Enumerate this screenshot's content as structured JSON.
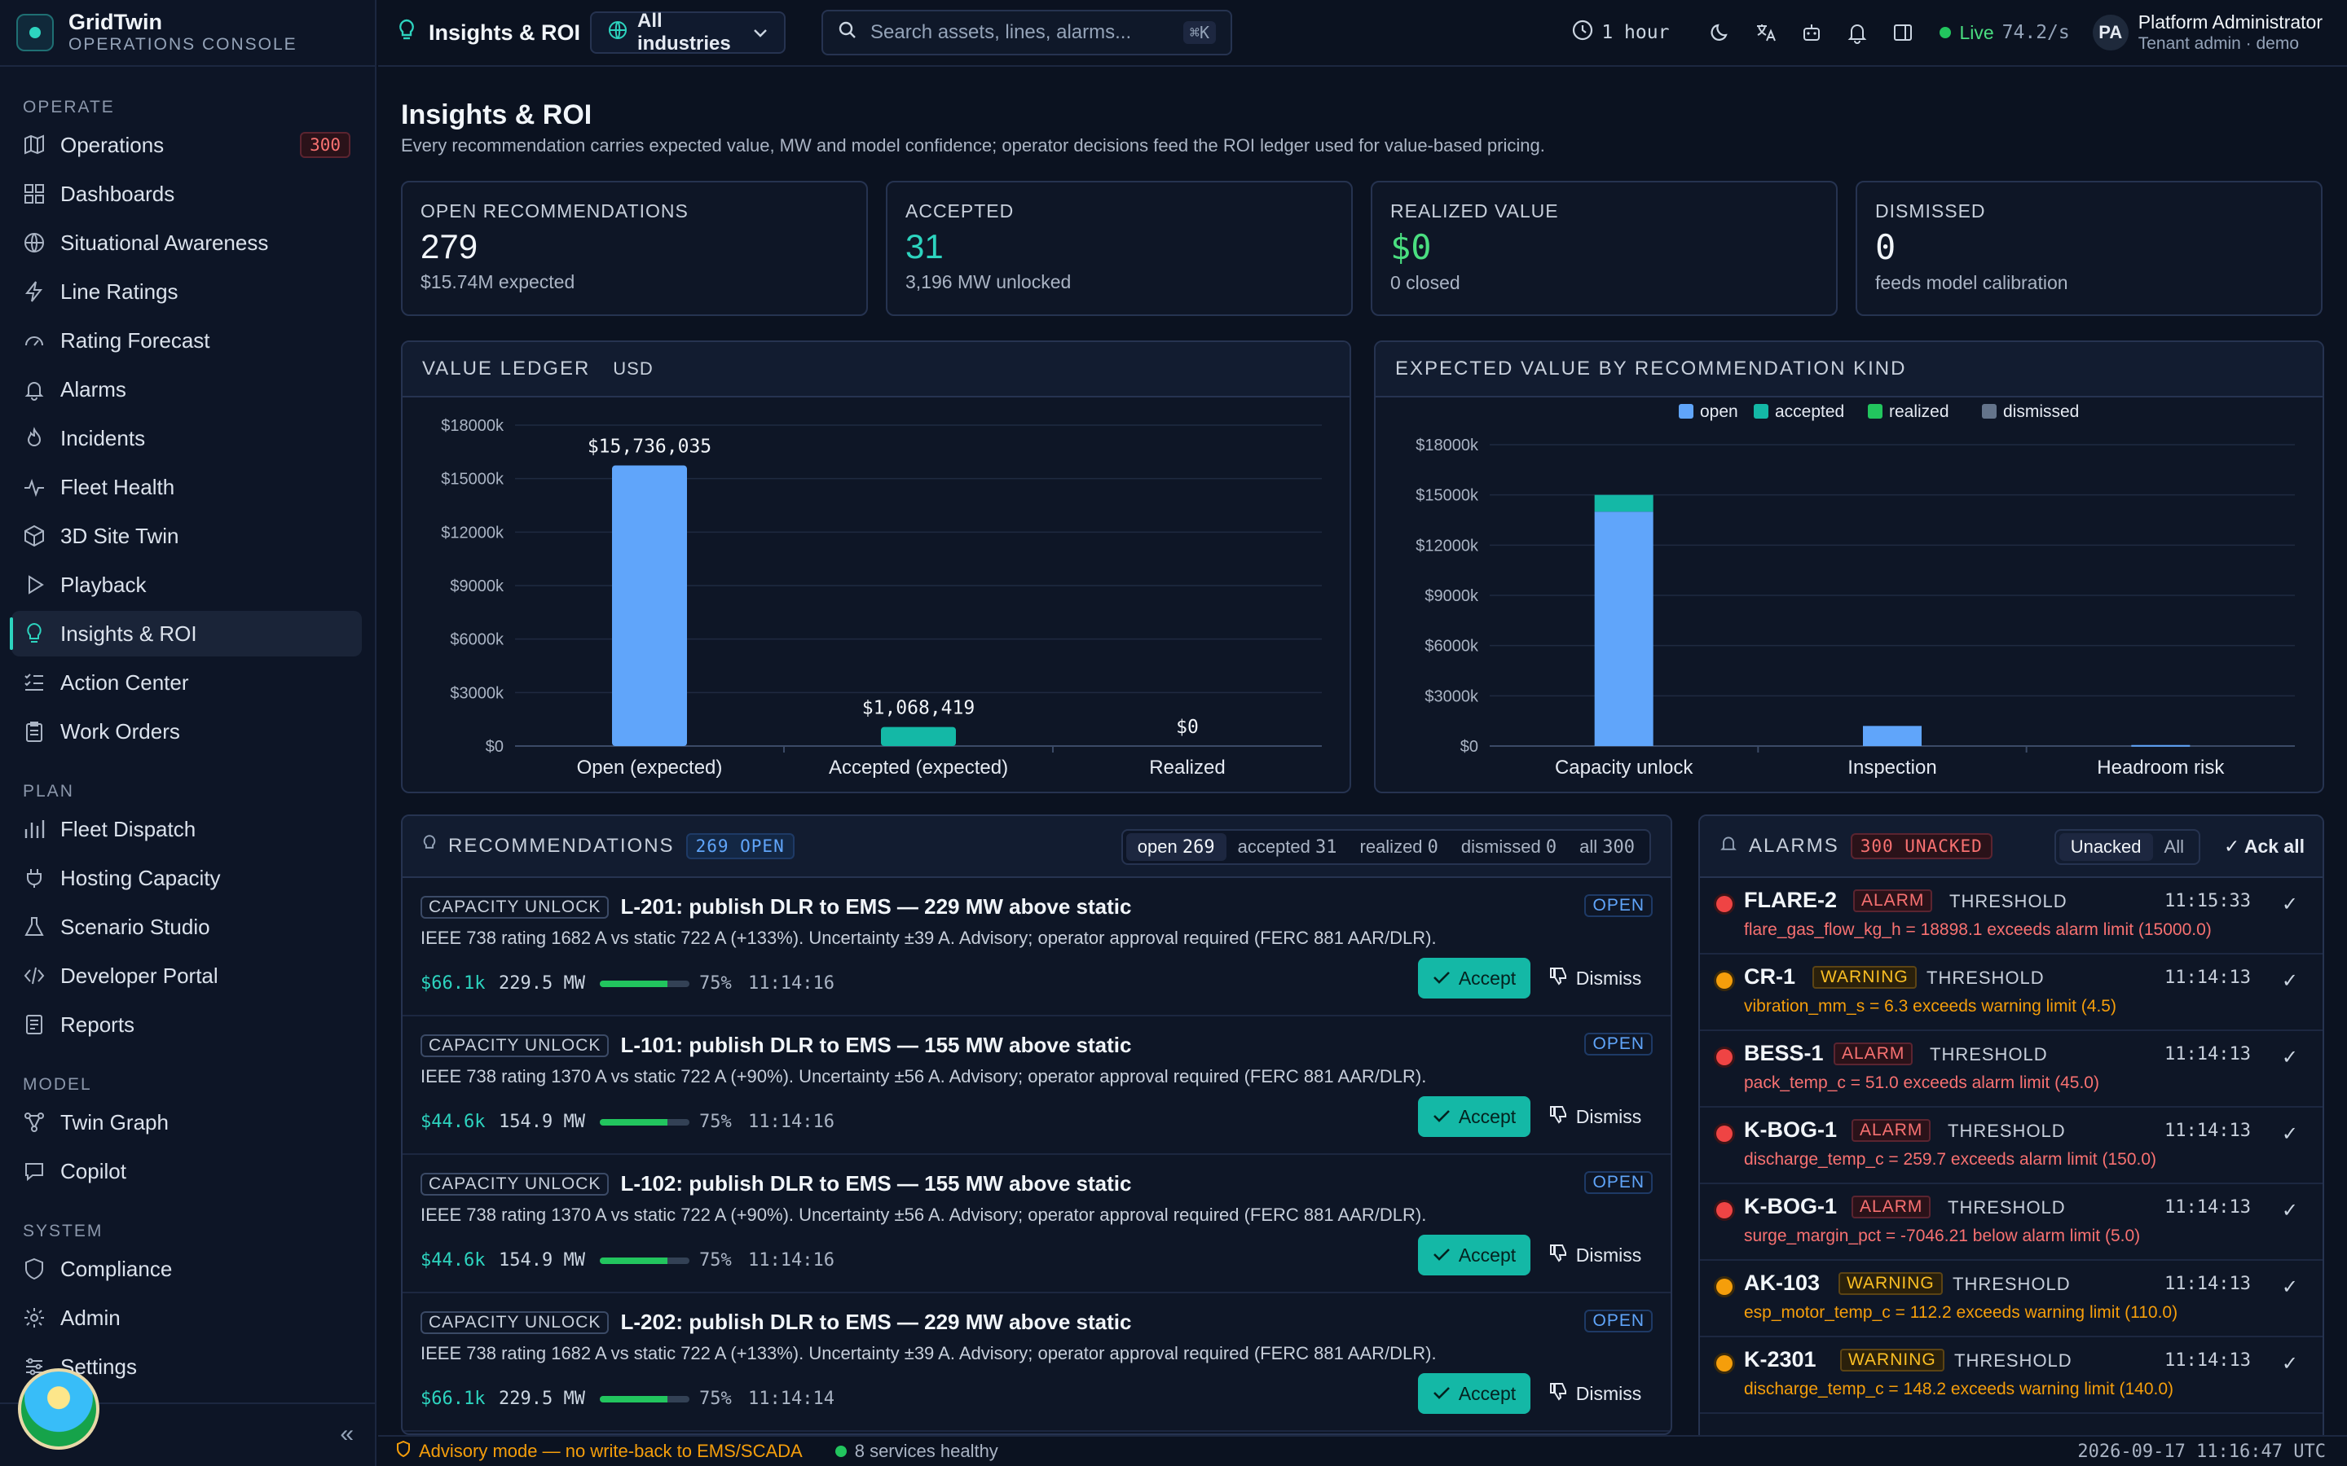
{
  "brand": {
    "name": "GridTwin",
    "subtitle": "OPERATIONS CONSOLE"
  },
  "sidebar": {
    "sections": [
      {
        "title": "OPERATE",
        "items": [
          {
            "label": "Operations",
            "icon": "map-icon",
            "badge": "300"
          },
          {
            "label": "Dashboards",
            "icon": "grid-icon"
          },
          {
            "label": "Situational Awareness",
            "icon": "globe-icon"
          },
          {
            "label": "Line Ratings",
            "icon": "bolt-icon"
          },
          {
            "label": "Rating Forecast",
            "icon": "gauge-icon"
          },
          {
            "label": "Alarms",
            "icon": "bell-icon"
          },
          {
            "label": "Incidents",
            "icon": "flame-icon"
          },
          {
            "label": "Fleet Health",
            "icon": "pulse-icon"
          },
          {
            "label": "3D Site Twin",
            "icon": "cube-icon"
          },
          {
            "label": "Playback",
            "icon": "play-icon"
          },
          {
            "label": "Insights & ROI",
            "icon": "bulb-icon",
            "active": true
          },
          {
            "label": "Action Center",
            "icon": "checklist-icon"
          },
          {
            "label": "Work Orders",
            "icon": "clipboard-icon"
          }
        ]
      },
      {
        "title": "PLAN",
        "items": [
          {
            "label": "Fleet Dispatch",
            "icon": "bar-chart-icon"
          },
          {
            "label": "Hosting Capacity",
            "icon": "plug-icon"
          },
          {
            "label": "Scenario Studio",
            "icon": "flask-icon"
          },
          {
            "label": "Developer Portal",
            "icon": "code-icon"
          },
          {
            "label": "Reports",
            "icon": "report-icon"
          }
        ]
      },
      {
        "title": "MODEL",
        "items": [
          {
            "label": "Twin Graph",
            "icon": "network-icon"
          },
          {
            "label": "Copilot",
            "icon": "chat-icon"
          }
        ]
      },
      {
        "title": "SYSTEM",
        "items": [
          {
            "label": "Compliance",
            "icon": "shield-icon"
          },
          {
            "label": "Admin",
            "icon": "gear-icon"
          },
          {
            "label": "Settings",
            "icon": "sliders-icon"
          }
        ]
      }
    ]
  },
  "topbar": {
    "title": "Insights & ROI",
    "industry": "All industries",
    "search_placeholder": "Search assets, lines, alarms...",
    "search_shortcut": "⌘K",
    "time_range": "1 hour",
    "live_label": "Live",
    "live_rate": "74.2/s",
    "user_initials": "PA",
    "user_name": "Platform Administrator",
    "user_role": "Tenant admin · demo"
  },
  "page": {
    "title": "Insights & ROI",
    "subtitle": "Every recommendation carries expected value, MW and model confidence; operator decisions feed the ROI ledger used for value-based pricing."
  },
  "kpis": [
    {
      "label": "OPEN RECOMMENDATIONS",
      "value": "279",
      "sub": "$15.74M expected",
      "color": "#f1f5f9"
    },
    {
      "label": "ACCEPTED",
      "value": "31",
      "sub": "3,196 MW unlocked",
      "color": "#2dd4bf"
    },
    {
      "label": "REALIZED VALUE",
      "value": "$0",
      "sub": "0 closed",
      "color": "#4ade80"
    },
    {
      "label": "DISMISSED",
      "value": "0",
      "sub": "feeds model calibration",
      "color": "#f1f5f9"
    }
  ],
  "ledger_panel": {
    "title": "VALUE LEDGER",
    "unit": "USD"
  },
  "kind_panel": {
    "title": "EXPECTED VALUE BY RECOMMENDATION KIND"
  },
  "chart_data": [
    {
      "type": "bar",
      "categories": [
        "Open (expected)",
        "Accepted (expected)",
        "Realized"
      ],
      "values": [
        15736035,
        1068419,
        0
      ],
      "data_labels": [
        "$15,736,035",
        "$1,068,419",
        "$0"
      ],
      "colors": [
        "#60a5fa",
        "#14b8a6",
        "#22c55e"
      ],
      "yticks": [
        "$0",
        "$3000k",
        "$6000k",
        "$9000k",
        "$12000k",
        "$15000k",
        "$18000k"
      ],
      "ylim": [
        0,
        18000000
      ],
      "grid": true
    },
    {
      "type": "bar",
      "stacked": true,
      "categories": [
        "Capacity unlock",
        "Inspection",
        "Headroom risk"
      ],
      "series": [
        {
          "name": "open",
          "color": "#60a5fa",
          "values": [
            14000000,
            1200000,
            60000
          ]
        },
        {
          "name": "accepted",
          "color": "#14b8a6",
          "values": [
            1000000,
            0,
            0
          ]
        },
        {
          "name": "realized",
          "color": "#22c55e",
          "values": [
            0,
            0,
            0
          ]
        },
        {
          "name": "dismissed",
          "color": "#64748b",
          "values": [
            0,
            0,
            0
          ]
        }
      ],
      "yticks": [
        "$0",
        "$3000k",
        "$6000k",
        "$9000k",
        "$12000k",
        "$15000k",
        "$18000k"
      ],
      "ylim": [
        0,
        18000000
      ],
      "legend": "top",
      "grid": true
    }
  ],
  "recommendations": {
    "title": "RECOMMENDATIONS",
    "count": "269 OPEN",
    "filters": [
      {
        "label": "open",
        "count": "269",
        "active": true
      },
      {
        "label": "accepted",
        "count": "31"
      },
      {
        "label": "realized",
        "count": "0"
      },
      {
        "label": "dismissed",
        "count": "0"
      },
      {
        "label": "all",
        "count": "300"
      }
    ],
    "accept_label": "Accept",
    "dismiss_label": "Dismiss",
    "items": [
      {
        "kind": "CAPACITY UNLOCK",
        "title": "L-201: publish DLR to EMS — 229 MW above static",
        "status": "OPEN",
        "desc": "IEEE 738 rating 1682 A vs static 722 A (+133%). Uncertainty ±39 A. Advisory; operator approval required (FERC 881 AAR/DLR).",
        "value": "$66.1k",
        "mw": "229.5 MW",
        "confidence": 0.75,
        "confidence_label": "75%",
        "time": "11:14:16"
      },
      {
        "kind": "CAPACITY UNLOCK",
        "title": "L-101: publish DLR to EMS — 155 MW above static",
        "status": "OPEN",
        "desc": "IEEE 738 rating 1370 A vs static 722 A (+90%). Uncertainty ±56 A. Advisory; operator approval required (FERC 881 AAR/DLR).",
        "value": "$44.6k",
        "mw": "154.9 MW",
        "confidence": 0.75,
        "confidence_label": "75%",
        "time": "11:14:16"
      },
      {
        "kind": "CAPACITY UNLOCK",
        "title": "L-102: publish DLR to EMS — 155 MW above static",
        "status": "OPEN",
        "desc": "IEEE 738 rating 1370 A vs static 722 A (+90%). Uncertainty ±56 A. Advisory; operator approval required (FERC 881 AAR/DLR).",
        "value": "$44.6k",
        "mw": "154.9 MW",
        "confidence": 0.75,
        "confidence_label": "75%",
        "time": "11:14:16"
      },
      {
        "kind": "CAPACITY UNLOCK",
        "title": "L-202: publish DLR to EMS — 229 MW above static",
        "status": "OPEN",
        "desc": "IEEE 738 rating 1682 A vs static 722 A (+133%). Uncertainty ±39 A. Advisory; operator approval required (FERC 881 AAR/DLR).",
        "value": "$66.1k",
        "mw": "229.5 MW",
        "confidence": 0.75,
        "confidence_label": "75%",
        "time": "11:14:14"
      }
    ]
  },
  "alarms": {
    "title": "ALARMS",
    "count": "300 UNACKED",
    "filters": [
      {
        "label": "Unacked",
        "active": true
      },
      {
        "label": "All"
      }
    ],
    "ack_all": "Ack all",
    "items": [
      {
        "asset": "FLARE-2",
        "severity": "ALARM",
        "type": "THRESHOLD",
        "time": "11:15:33",
        "msg": "flare_gas_flow_kg_h = 18898.1 exceeds alarm limit (15000.0)"
      },
      {
        "asset": "CR-1",
        "severity": "WARNING",
        "type": "THRESHOLD",
        "time": "11:14:13",
        "msg": "vibration_mm_s = 6.3 exceeds warning limit (4.5)"
      },
      {
        "asset": "BESS-1",
        "severity": "ALARM",
        "type": "THRESHOLD",
        "time": "11:14:13",
        "msg": "pack_temp_c = 51.0 exceeds alarm limit (45.0)"
      },
      {
        "asset": "K-BOG-1",
        "severity": "ALARM",
        "type": "THRESHOLD",
        "time": "11:14:13",
        "msg": "discharge_temp_c = 259.7 exceeds alarm limit (150.0)"
      },
      {
        "asset": "K-BOG-1",
        "severity": "ALARM",
        "type": "THRESHOLD",
        "time": "11:14:13",
        "msg": "surge_margin_pct = -7046.21 below alarm limit (5.0)"
      },
      {
        "asset": "AK-103",
        "severity": "WARNING",
        "type": "THRESHOLD",
        "time": "11:14:13",
        "msg": "esp_motor_temp_c = 112.2 exceeds warning limit (110.0)"
      },
      {
        "asset": "K-2301",
        "severity": "WARNING",
        "type": "THRESHOLD",
        "time": "11:14:13",
        "msg": "discharge_temp_c = 148.2 exceeds warning limit (140.0)"
      }
    ]
  },
  "status": {
    "advisory": "Advisory mode — no write-back to EMS/SCADA",
    "services": "8 services healthy",
    "clock": "2026-09-17 11:16:47 UTC"
  },
  "colors": {
    "accent": "#2dd4bf",
    "alarm": "#ef4444",
    "warning": "#f59e0b",
    "open": "#60a5fa"
  }
}
